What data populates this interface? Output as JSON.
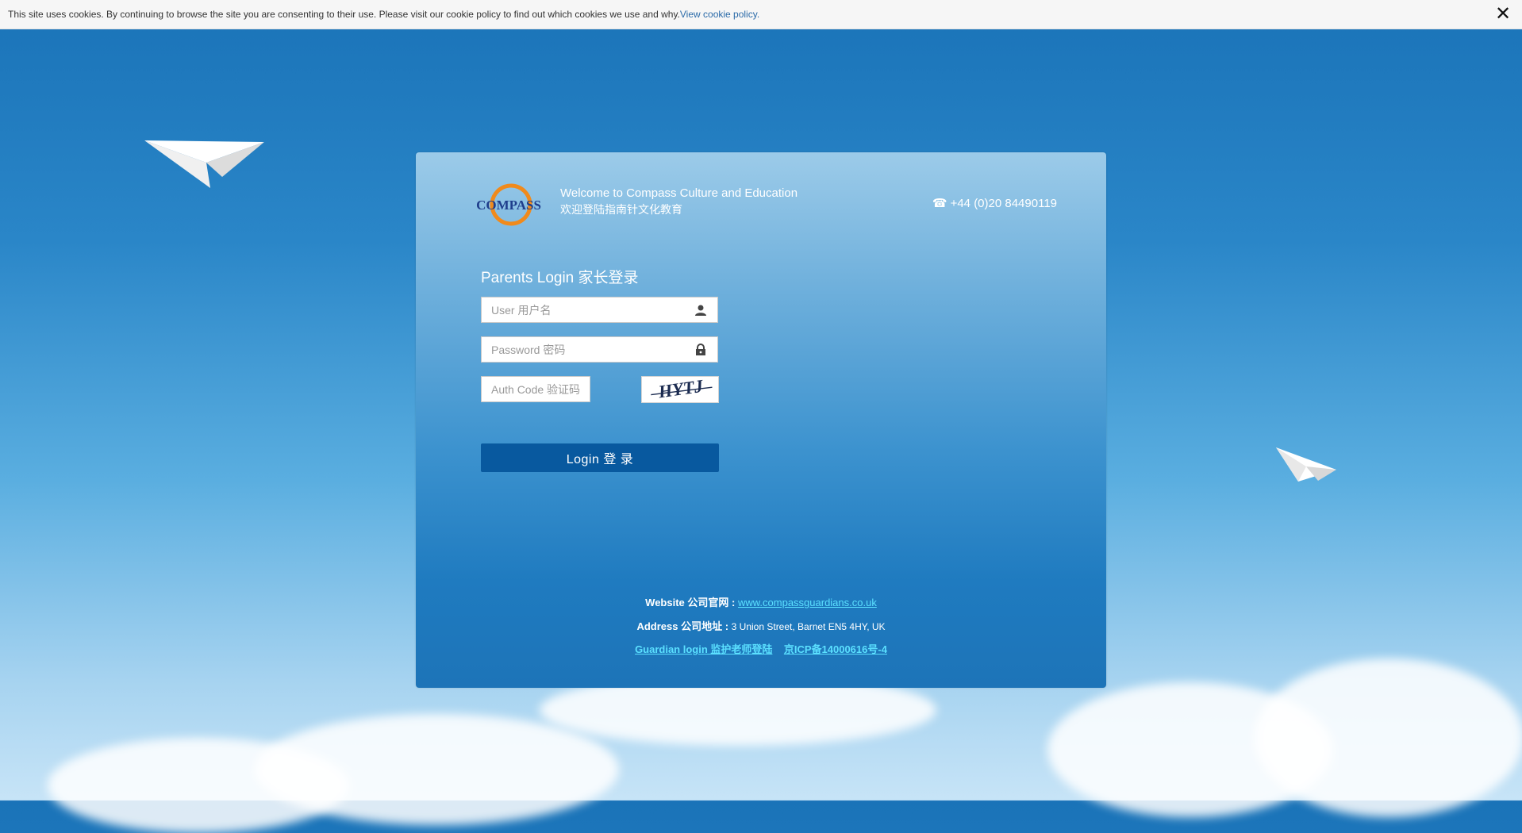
{
  "cookie_bar": {
    "text": "This site uses cookies. By continuing to browse the site you are consenting to their use. Please visit our cookie policy to find out which cookies we use and why.",
    "link_label": "View cookie policy.",
    "close_label": "✕"
  },
  "brand": {
    "logo_text": "COMPASS",
    "welcome_en": "Welcome to Compass Culture and Education",
    "welcome_cn": "欢迎登陆指南针文化教育",
    "phone": "+44 (0)20 84490119"
  },
  "login": {
    "title": "Parents Login 家长登录",
    "user_placeholder": "User 用户名",
    "password_placeholder": "Password 密码",
    "auth_placeholder": "Auth Code 验证码",
    "captcha_text": "HYTJ",
    "button_label": "Login 登 录"
  },
  "footer": {
    "website_label": "Website 公司官网 :",
    "website_link": "www.compassguardians.co.uk",
    "address_label": "Address 公司地址 :",
    "address_value": "3 Union Street, Barnet EN5 4HY, UK",
    "guardian_link": "Guardian login 监护老师登陆",
    "icp_link": "京ICP备14000616号-4"
  },
  "colors": {
    "login_button": "#08599f",
    "footer_link": "#5be0ff",
    "cookie_link": "#2a6aa8"
  }
}
